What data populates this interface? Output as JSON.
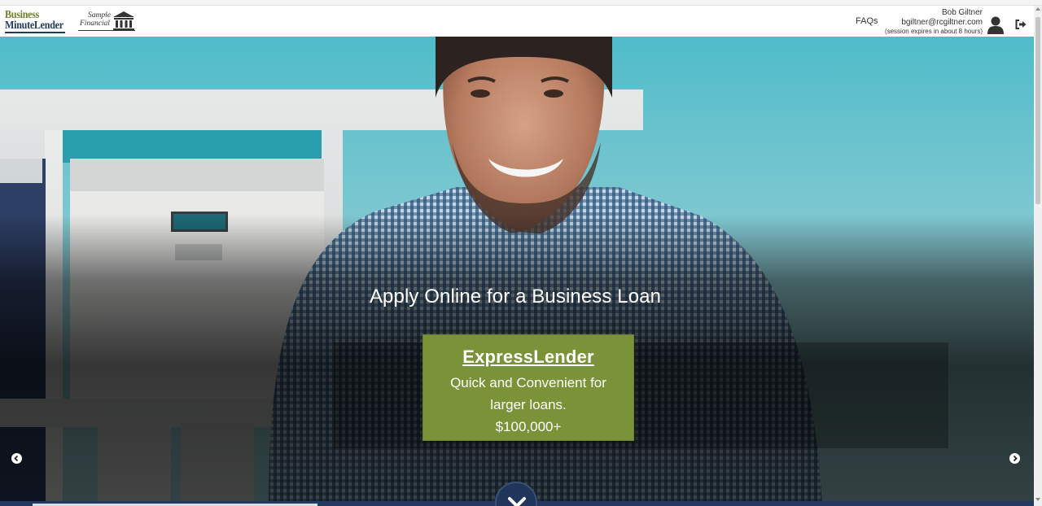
{
  "header": {
    "brand_line1": "Business",
    "brand_line2": "MinuteLender",
    "partner_line1": "Sample",
    "partner_line2": "Financial",
    "faqs_label": "FAQs",
    "user_name": "Bob Giltner",
    "user_email": "bgiltner@rcgiltner.com",
    "session_text": "(session expires in about 8 hours)"
  },
  "hero": {
    "headline": "Apply Online for a Business Loan",
    "cta": {
      "title": "ExpressLender",
      "description": "Quick and Convenient for larger loans.",
      "amount": "$100,000+"
    }
  },
  "icons": {
    "bank": "bank-icon",
    "user": "user-icon",
    "logout": "logout-icon",
    "prev": "chevron-left-icon",
    "next": "chevron-right-icon",
    "scroll": "chevron-down-icon"
  },
  "colors": {
    "brand_green": "#6d7f2c",
    "brand_navy": "#223a5e",
    "cta_green": "#7a9338",
    "hero_teal": "#4fbcc9"
  }
}
